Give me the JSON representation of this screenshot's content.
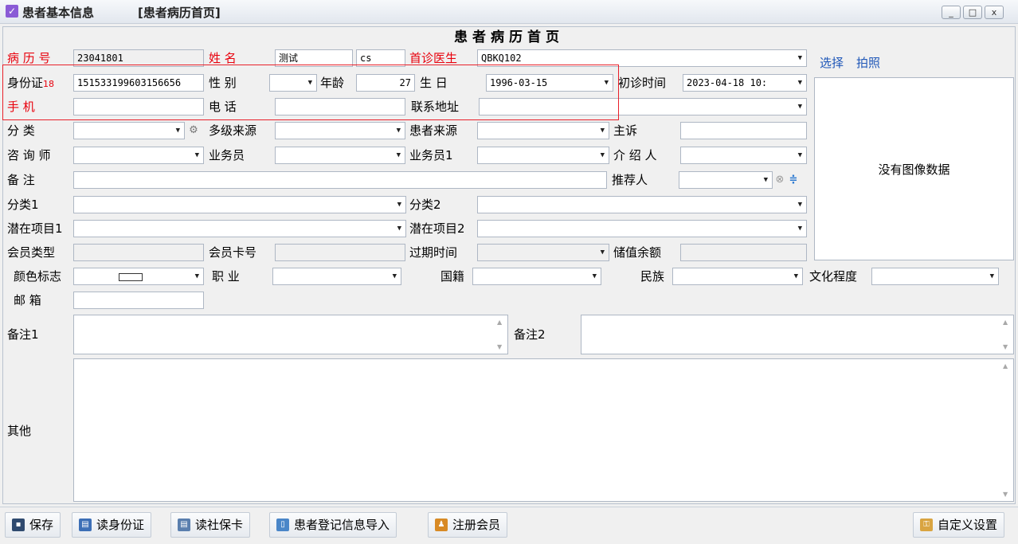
{
  "window": {
    "title": "患者基本信息",
    "subtitle": "[患者病历首页]",
    "buttons": {
      "minimize": "_",
      "maximize": "□",
      "close": "x"
    }
  },
  "page_title": "患者病历首页",
  "photo": {
    "select_label": "选择",
    "capture_label": "拍照",
    "empty_text": "没有图像数据"
  },
  "fields": {
    "record_no": {
      "label": "病 历 号",
      "value": "23041801"
    },
    "name": {
      "label": "姓    名",
      "value": "测试",
      "extra": "cs"
    },
    "first_doctor": {
      "label": "首诊医生",
      "value": "QBKQ102"
    },
    "id_card": {
      "label": "身份证",
      "count": "18",
      "value": "151533199603156656"
    },
    "gender": {
      "label": "性    别",
      "value": ""
    },
    "age": {
      "label": "年龄",
      "value": "27"
    },
    "birthday": {
      "label": "生    日",
      "value": "1996-03-15"
    },
    "first_visit": {
      "label": "初诊时间",
      "value": "2023-04-18 10:"
    },
    "mobile": {
      "label": "手    机",
      "value": ""
    },
    "phone": {
      "label": "电    话",
      "value": ""
    },
    "address": {
      "label": "联系地址",
      "value": ""
    },
    "category": {
      "label": "分    类",
      "value": ""
    },
    "multi_source": {
      "label": "多级来源",
      "value": ""
    },
    "patient_source": {
      "label": "患者来源",
      "value": ""
    },
    "complaint": {
      "label": "主诉",
      "value": ""
    },
    "consultant": {
      "label": "咨 询 师",
      "value": ""
    },
    "salesman": {
      "label": "业务员",
      "value": ""
    },
    "salesman1": {
      "label": "业务员1",
      "value": ""
    },
    "introducer": {
      "label": "介 绍 人",
      "value": ""
    },
    "remarks": {
      "label": "备    注",
      "value": ""
    },
    "referrer": {
      "label": "推荐人",
      "value": ""
    },
    "category1": {
      "label": "分类1",
      "value": ""
    },
    "category2": {
      "label": "分类2",
      "value": ""
    },
    "potential1": {
      "label": "潜在项目1",
      "value": ""
    },
    "potential2": {
      "label": "潜在项目2",
      "value": ""
    },
    "member_type": {
      "label": "会员类型",
      "value": ""
    },
    "member_card": {
      "label": "会员卡号",
      "value": ""
    },
    "expire_time": {
      "label": "过期时间",
      "value": ""
    },
    "balance": {
      "label": "储值余额",
      "value": ""
    },
    "color_mark": {
      "label": "颜色标志"
    },
    "occupation": {
      "label": "职    业",
      "value": ""
    },
    "nationality": {
      "label": "国籍",
      "value": ""
    },
    "ethnicity": {
      "label": "民族",
      "value": ""
    },
    "education": {
      "label": "文化程度",
      "value": ""
    },
    "email": {
      "label": "邮    箱",
      "value": ""
    },
    "note1": {
      "label": "备注1",
      "value": ""
    },
    "note2": {
      "label": "备注2",
      "value": ""
    },
    "other": {
      "label": "其他",
      "value": ""
    }
  },
  "toolbar": {
    "save": "保存",
    "read_id": "读身份证",
    "read_social": "读社保卡",
    "import": "患者登记信息导入",
    "register_member": "注册会员",
    "custom_settings": "自定义设置"
  },
  "colors": {
    "required_label": "#e8000c",
    "link": "#1f57b8",
    "highlight_box": "#e8202a"
  }
}
